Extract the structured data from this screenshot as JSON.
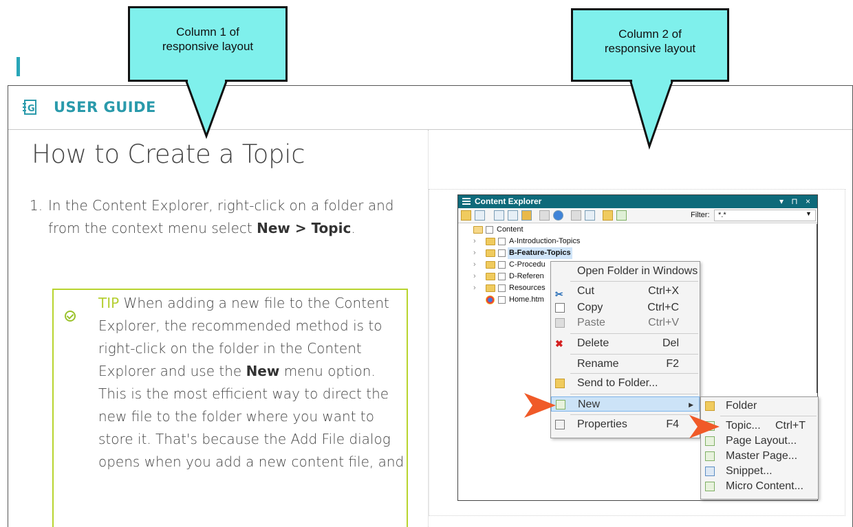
{
  "callouts": {
    "col1": "Column 1 of responsive layout",
    "col2": "Column 2 of responsive layout"
  },
  "header": {
    "brand": "USER GUIDE",
    "logo_letter": "G"
  },
  "page": {
    "title": "How to Create a Topic",
    "step1": {
      "number": "1.",
      "text_a": "In the Content Explorer, right-click on a folder and from the context menu select ",
      "bold": "New > Topic",
      "text_b": "."
    },
    "tip": {
      "label": "TIP",
      "text_a": " When adding a new file to the Content Explorer, the recommended method is to right-click on the folder in the Content Explorer and use the ",
      "bold": "New",
      "text_b": " menu option. This is the most efficient way to direct the new file to the folder where you want to store it. That's because the Add File dialog opens when you add a new content file, and"
    }
  },
  "app": {
    "title": "Content Explorer",
    "window_controls": "▾ ⊓ ×",
    "filter_label": "Filter:",
    "filter_value": "*.*",
    "tree": [
      {
        "label": "Content",
        "icon": "folder-open-icon"
      },
      {
        "label": "A-Introduction-Topics",
        "icon": "folder-icon"
      },
      {
        "label": "B-Feature-Topics",
        "icon": "folder-icon",
        "selected": true
      },
      {
        "label": "C-Procedu",
        "icon": "folder-icon"
      },
      {
        "label": "D-Referen",
        "icon": "folder-icon"
      },
      {
        "label": "Resources",
        "icon": "folder-icon"
      },
      {
        "label": "Home.htm",
        "icon": "browser-icon"
      }
    ],
    "context_menu": [
      {
        "label": "Open Folder in Windows",
        "shortcut": ""
      },
      {
        "label": "Cut",
        "shortcut": "Ctrl+X",
        "icon": "cut-icon"
      },
      {
        "label": "Copy",
        "shortcut": "Ctrl+C",
        "icon": "copy-icon"
      },
      {
        "label": "Paste",
        "shortcut": "Ctrl+V",
        "icon": "paste-icon",
        "disabled": true
      },
      {
        "label": "Delete",
        "shortcut": "Del",
        "icon": "delete-icon"
      },
      {
        "label": "Rename",
        "shortcut": "F2"
      },
      {
        "label": "Send to Folder...",
        "shortcut": "",
        "icon": "send-to-folder-icon"
      },
      {
        "label": "New",
        "shortcut": "",
        "icon": "new-icon",
        "highlighted": true
      },
      {
        "label": "Properties",
        "shortcut": "F4",
        "icon": "properties-icon"
      }
    ],
    "submenu": [
      {
        "label": "Folder",
        "shortcut": "",
        "icon": "folder-icon"
      },
      {
        "label": "Topic...",
        "shortcut": "Ctrl+T",
        "icon": "topic-icon"
      },
      {
        "label": "Page Layout...",
        "shortcut": "",
        "icon": "page-layout-icon"
      },
      {
        "label": "Master Page...",
        "shortcut": "",
        "icon": "master-page-icon"
      },
      {
        "label": "Snippet...",
        "shortcut": "",
        "icon": "snippet-icon"
      },
      {
        "label": "Micro Content...",
        "shortcut": "",
        "icon": "micro-content-icon"
      }
    ]
  },
  "colors": {
    "accent": "#2a9aab",
    "tip_border": "#b8d42e",
    "callout_fill": "#7ff0ec",
    "arrow": "#f05a28"
  }
}
